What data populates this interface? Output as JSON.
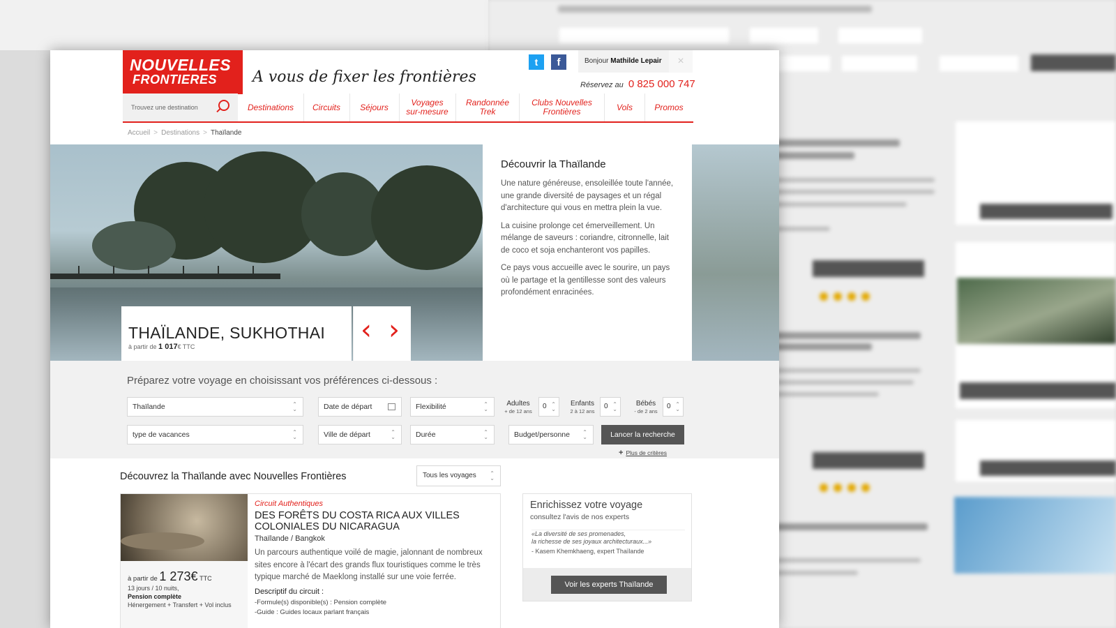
{
  "header": {
    "logo_line1": "NOUVELLES",
    "logo_line2": "FRONTIERES",
    "tagline": "A vous de fixer les frontières",
    "greeting": "Bonjour",
    "user": "Mathilde Lepair",
    "reserve_label": "Réservez au",
    "phone": "0 825 000 747",
    "twitter": "t",
    "facebook": "f",
    "close": "×"
  },
  "nav": {
    "search_placeholder": "Trouvez une destination",
    "items": [
      {
        "label": "Destinations"
      },
      {
        "label": "Circuits"
      },
      {
        "label": "Séjours"
      },
      {
        "label": "Voyages sur-mesure"
      },
      {
        "label": "Randonnée Trek"
      },
      {
        "label": "Clubs Nouvelles Frontières"
      },
      {
        "label": "Vols"
      },
      {
        "label": "Promos"
      }
    ]
  },
  "breadcrumb": [
    "Accueil",
    "Destinations",
    "Thaïlande"
  ],
  "hero": {
    "title": "THAÏLANDE, SUKHOTHAI",
    "price_prefix": "à partir de",
    "price": "1 017",
    "price_suffix": "€ TTC",
    "prev": "‹",
    "next": "›"
  },
  "discover": {
    "title": "Découvrir la Thaïlande",
    "paragraphs": [
      "Une nature généreuse, ensoleillée toute l'année, une grande diversité de paysages et un régal d'architecture qui vous en mettra plein la vue.",
      "La cuisine prolonge cet émerveillement. Un mélange de saveurs : coriandre, citronnelle, lait de coco et soja enchanteront vos papilles.",
      "Ce pays vous accueille avec le sourire, un pays où le partage et la gentillesse sont des valeurs profondément enracinées."
    ]
  },
  "form": {
    "heading": "Préparez votre voyage en choisissant vos préférences ci-dessous :",
    "destination": "Thaïlande",
    "date": "Date de départ",
    "flexibility": "Flexibilité",
    "adults_label": "Adultes",
    "adults_sub": "+ de 12 ans",
    "adults_value": "0",
    "children_label": "Enfants",
    "children_sub": "2 à 12 ans",
    "children_value": "0",
    "babies_label": "Bébés",
    "babies_sub": "- de 2 ans",
    "babies_value": "0",
    "holiday_type": "type de vacances",
    "departure_city": "Ville de départ",
    "duration": "Durée",
    "budget": "Budget/personne",
    "search_button": "Lancer la recherche",
    "more_criteria": "Plus de critères",
    "plus": "+"
  },
  "results": {
    "title": "Découvrez la Thaïlande avec Nouvelles Frontières",
    "filter": "Tous les voyages",
    "card": {
      "kind": "Circuit Authentiques",
      "title": "DES FORÊTS DU COSTA RICA AUX VILLES COLONIALES DU NICARAGUA",
      "route": "Thaïlande / Bangkok",
      "description": "Un parcours authentique voilé de magie, jalonnant de nombreux sites encore à l'écart des grands flux touristiques comme le très typique marché de Maeklong installé sur une voie ferrée.",
      "price_prefix": "à partir de",
      "price": "1 273€",
      "price_suffix": "TTC",
      "duration": "13 jours / 10 nuits,",
      "board": "Pension complète",
      "includes": "Hénergement + Transfert + Vol inclus",
      "subtitle": "Descriptif du circuit :",
      "features": [
        "-Formule(s) disponible(s) : Pension complète",
        "-Guide : Guides locaux parlant français"
      ]
    },
    "expert": {
      "title": "Enrichissez votre voyage",
      "subtitle": "consultez l'avis de nos experts",
      "quote_line1": "«La diversité de ses promenades,",
      "quote_line2": "la richesse de ses joyaux architecturaux...»",
      "author": "- Kasem Khemkhaeng, expert Thaïlande",
      "button": "Voir les experts Thaïlande"
    }
  },
  "colors": {
    "brand_red": "#e2211c",
    "button_dark": "#555555"
  }
}
